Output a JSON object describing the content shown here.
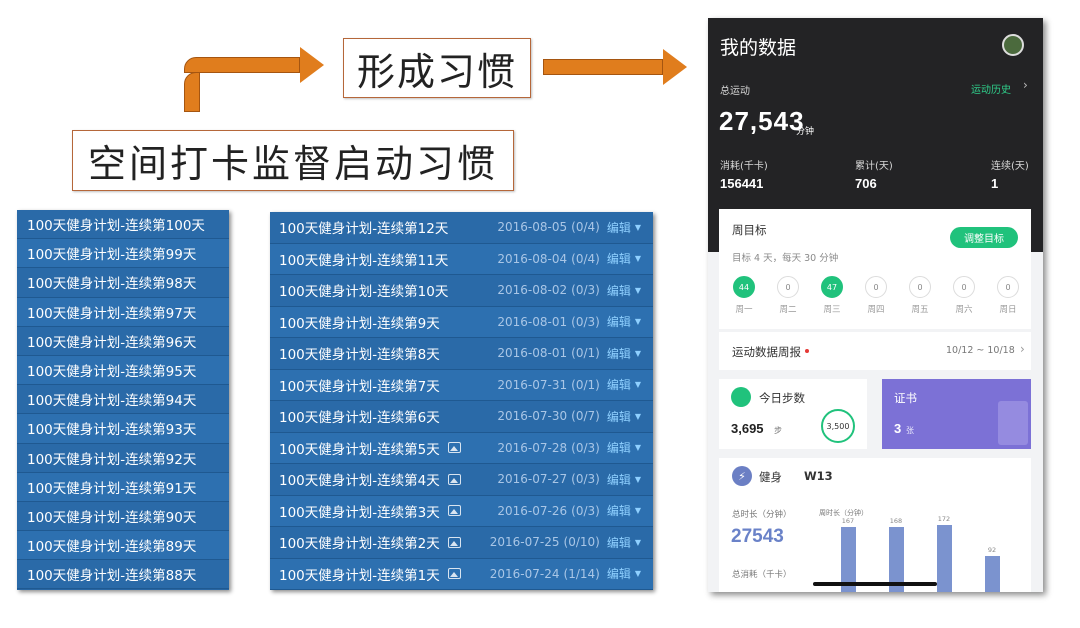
{
  "callouts": {
    "habit": "形成习惯",
    "start": "空间打卡监督启动习惯"
  },
  "colors": {
    "arrow": "#e07d1d",
    "list_bg": "#2866a3",
    "accent_green": "#20c27c",
    "certificate_purple": "#7c71d6"
  },
  "left_list": [
    "100天健身计划-连续第100天",
    "100天健身计划-连续第99天",
    "100天健身计划-连续第98天",
    "100天健身计划-连续第97天",
    "100天健身计划-连续第96天",
    "100天健身计划-连续第95天",
    "100天健身计划-连续第94天",
    "100天健身计划-连续第93天",
    "100天健身计划-连续第92天",
    "100天健身计划-连续第91天",
    "100天健身计划-连续第90天",
    "100天健身计划-连续第89天",
    "100天健身计划-连续第88天"
  ],
  "mid_list": [
    {
      "title": "100天健身计划-连续第12天",
      "image": false,
      "date": "2016-08-05",
      "count": "(0/4)",
      "edit": "编辑"
    },
    {
      "title": "100天健身计划-连续第11天",
      "image": false,
      "date": "2016-08-04",
      "count": "(0/4)",
      "edit": "编辑"
    },
    {
      "title": "100天健身计划-连续第10天",
      "image": false,
      "date": "2016-08-02",
      "count": "(0/3)",
      "edit": "编辑"
    },
    {
      "title": "100天健身计划-连续第9天",
      "image": false,
      "date": "2016-08-01",
      "count": "(0/3)",
      "edit": "编辑"
    },
    {
      "title": "100天健身计划-连续第8天",
      "image": false,
      "date": "2016-08-01",
      "count": "(0/1)",
      "edit": "编辑"
    },
    {
      "title": "100天健身计划-连续第7天",
      "image": false,
      "date": "2016-07-31",
      "count": "(0/1)",
      "edit": "编辑"
    },
    {
      "title": "100天健身计划-连续第6天",
      "image": false,
      "date": "2016-07-30",
      "count": "(0/7)",
      "edit": "编辑"
    },
    {
      "title": "100天健身计划-连续第5天",
      "image": true,
      "date": "2016-07-28",
      "count": "(0/3)",
      "edit": "编辑"
    },
    {
      "title": "100天健身计划-连续第4天",
      "image": true,
      "date": "2016-07-27",
      "count": "(0/3)",
      "edit": "编辑"
    },
    {
      "title": "100天健身计划-连续第3天",
      "image": true,
      "date": "2016-07-26",
      "count": "(0/3)",
      "edit": "编辑"
    },
    {
      "title": "100天健身计划-连续第2天",
      "image": true,
      "date": "2016-07-25",
      "count": "(0/10)",
      "edit": "编辑"
    },
    {
      "title": "100天健身计划-连续第1天",
      "image": true,
      "date": "2016-07-24",
      "count": "(1/14)",
      "edit": "编辑"
    }
  ],
  "phone": {
    "title": "我的数据",
    "total_label": "总运动",
    "history_link": "运动历史",
    "total_value": "27,543",
    "total_unit": "分钟",
    "stats": [
      {
        "label": "消耗(千卡)",
        "value": "156441"
      },
      {
        "label": "累计(天)",
        "value": "706"
      },
      {
        "label": "连续(天)",
        "value": "1"
      }
    ],
    "weekly": {
      "title": "周目标",
      "adjust_button": "调整目标",
      "subtitle": "目标 4 天，每天 30 分钟",
      "days": [
        {
          "value": "44",
          "label": "周一",
          "done": true
        },
        {
          "value": "0",
          "label": "周二",
          "done": false
        },
        {
          "value": "47",
          "label": "周三",
          "done": true
        },
        {
          "value": "0",
          "label": "周四",
          "done": false
        },
        {
          "value": "0",
          "label": "周五",
          "done": false
        },
        {
          "value": "0",
          "label": "周六",
          "done": false
        },
        {
          "value": "0",
          "label": "周日",
          "done": false
        }
      ]
    },
    "report": {
      "title": "运动数据周报",
      "range": "10/12 ~ 10/18"
    },
    "steps": {
      "title": "今日步数",
      "value": "3,695",
      "unit": "步",
      "goal": "3,500"
    },
    "certificate": {
      "title": "证书",
      "value": "3",
      "unit": "张"
    },
    "fitness": {
      "title": "健身",
      "week": "W13"
    },
    "duration": {
      "label": "总时长（分钟）",
      "value": "27543",
      "next_label": "总消耗（千卡）"
    },
    "weekly_chart": {
      "label": "周时长（分钟）"
    }
  },
  "chart_data": {
    "type": "bar",
    "title": "",
    "xlabel": "",
    "ylabel": "周时长（分钟）",
    "categories": [
      "",
      "",
      "",
      ""
    ],
    "values": [
      167,
      168,
      172,
      92
    ],
    "ylim": [
      0,
      180
    ]
  }
}
